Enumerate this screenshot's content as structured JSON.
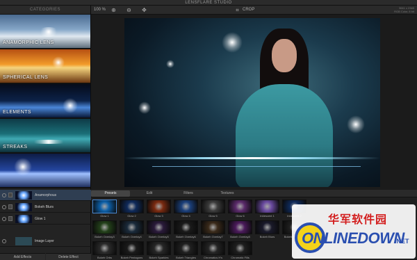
{
  "window": {
    "title": "LENSFLARE STUDIO"
  },
  "sidebar": {
    "header": "CATEGORIES",
    "categories": [
      {
        "label": "ANAMORPHIC LENS"
      },
      {
        "label": "SPHERICAL LENS"
      },
      {
        "label": "ELEMENTS"
      },
      {
        "label": "STREAKS"
      },
      {
        "label": ""
      }
    ]
  },
  "toolbar": {
    "zoom": "100 %",
    "crop_label": "CROP",
    "image_size": "3641 x 2340",
    "color_info": "RGB Color, 8 bit"
  },
  "effects": {
    "layers": [
      {
        "name": "Anamorphous"
      },
      {
        "name": "Bokeh Blurs"
      },
      {
        "name": "Glow 1"
      }
    ],
    "image_layer": "Image Layer",
    "add_label": "Add Effects",
    "delete_label": "Delete Effect"
  },
  "presets": {
    "tabs": [
      "Presets",
      "Edit",
      "Filters",
      "Textures"
    ],
    "items": [
      {
        "name": "Glow 1",
        "color": "#0c5fa8"
      },
      {
        "name": "Glow 2",
        "color": "#0f2a5a"
      },
      {
        "name": "Glow 3",
        "color": "#7a2a10"
      },
      {
        "name": "Glow 4",
        "color": "#1b3f7a"
      },
      {
        "name": "Glow 5",
        "color": "#3b3b3b"
      },
      {
        "name": "Glow 6",
        "color": "#5a2a6a"
      },
      {
        "name": "Iridescent 1",
        "color": "#6a4aa0"
      },
      {
        "name": "Iridescent 2",
        "color": "#0f2a5a"
      },
      {
        "name": "Bokeh Overlay3",
        "color": "#23401a"
      },
      {
        "name": "Bokeh Overlay4",
        "color": "#1a2a3a"
      },
      {
        "name": "Bokeh Overlay5",
        "color": "#2a1a3a"
      },
      {
        "name": "Bokeh Overlay6",
        "color": "#1a1a1a"
      },
      {
        "name": "Bokeh Overlay7",
        "color": "#3a2a1a"
      },
      {
        "name": "Bokeh Overlay8",
        "color": "#4a1a5a"
      },
      {
        "name": "Bokeh Blurs",
        "color": "#1a1a2a"
      },
      {
        "name": "Bokeh Octagons",
        "color": "#202020"
      },
      {
        "name": "Bokeh Orbs",
        "color": "#2a2a2a"
      },
      {
        "name": "Bokeh Pentagons",
        "color": "#1a1a1a"
      },
      {
        "name": "Bokeh Sparkles",
        "color": "#262626"
      },
      {
        "name": "Bokeh Triangles",
        "color": "#202020"
      },
      {
        "name": "Chromatics H's",
        "color": "#242424"
      },
      {
        "name": "Chromatic Fills",
        "color": "#1e1e1e"
      }
    ]
  },
  "watermark": {
    "cn": "华军软件园",
    "en": "ONLINEDOWN",
    "tld": ".NET"
  }
}
